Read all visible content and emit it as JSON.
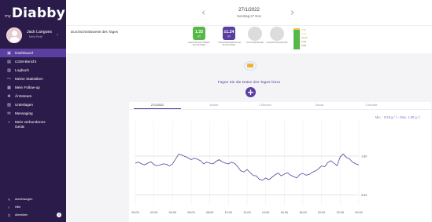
{
  "brand": {
    "prefix": "my",
    "name": "Diabby"
  },
  "user": {
    "name": "Jack Langues",
    "role": "Mein Profil",
    "caret": "⌄"
  },
  "nav": [
    {
      "label": "Dashboard",
      "icon": "▣",
      "icon_name": "dashboard-icon",
      "active": true
    },
    {
      "label": "CGM-Bericht",
      "icon": "▤",
      "icon_name": "report-icon"
    },
    {
      "label": "Logbuch",
      "icon": "▥",
      "icon_name": "logbook-icon"
    },
    {
      "label": "Meine Statistiken",
      "icon": "〜",
      "icon_name": "statistics-icon"
    },
    {
      "label": "Mein Follow-up",
      "icon": "▦",
      "icon_name": "followup-icon"
    },
    {
      "label": "Ärzteteam",
      "icon": "✚",
      "icon_name": "doctor-team-icon"
    },
    {
      "label": "Unterlagen",
      "icon": "▧",
      "icon_name": "documents-icon"
    },
    {
      "label": "Messaging",
      "icon": "✉",
      "icon_name": "messaging-icon"
    },
    {
      "label": "Mein verbundenes Gerät",
      "icon": "⌁",
      "icon_name": "device-icon"
    }
  ],
  "bottom_links": [
    {
      "label": "Anmerkungen",
      "icon": "✎",
      "icon_name": "notes-icon"
    },
    {
      "label": "Hilfe",
      "icon": "?",
      "icon_name": "help-icon"
    },
    {
      "label": "Abmelden",
      "icon": "⏻",
      "icon_name": "logout-icon"
    }
  ],
  "info_icon": "i",
  "date": {
    "main": "27/1/2022",
    "sub": "Sonntag 27 Nov",
    "prev": "‹",
    "next": "›"
  },
  "averages": {
    "label": "Durchschnittswerte des Tages",
    "tiles": [
      {
        "value": "1.33",
        "unit": "g/l",
        "label": "DURCHSCHNITTSWERT BLUTZUCKER",
        "color": "#56b947"
      },
      {
        "value": "±1.24",
        "unit": "g/l",
        "label": "STANDARDABWEICHUNG BLUTZUCKER",
        "color": "#5a3fa0"
      }
    ],
    "circles": [
      {
        "label": "HYPOS ERKENNEN"
      },
      {
        "label": "GESAMTINSULINDOSIS"
      }
    ],
    "time_in_range": [
      {
        "value": "4.0%",
        "color": "#f2a43c"
      },
      {
        "value": "0.0%",
        "color": "#f2c64a"
      },
      {
        "value": "94.0%",
        "color": "#56b947"
      },
      {
        "value": "2.0%",
        "color": "#e24a3d"
      },
      {
        "value": "0.0%",
        "color": "#8c4a3d"
      }
    ]
  },
  "empty_state": {
    "text": "Fügen Sie die Daten des Tages hinzu",
    "add_label": "+"
  },
  "chart": {
    "tabs": [
      "27/1/2022",
      "Woche",
      "2 Wochen",
      "Monat",
      "3 Monate"
    ],
    "minmax": "Min. : 0,68 g / l – Max. 1,90 g / l",
    "x_labels": [
      "00:00",
      "02:00",
      "04:00",
      "06:00",
      "08:00",
      "10:00",
      "12:00",
      "14:00",
      "16:00",
      "18:00",
      "20:00",
      "22:00",
      "00:00"
    ]
  },
  "chart_data": {
    "type": "line",
    "ylim": [
      0.4,
      2.8
    ],
    "thresholds": [
      {
        "value": 1.8,
        "label": "1.80"
      },
      {
        "value": 0.7,
        "label": "0.69"
      }
    ],
    "series": [
      {
        "color": "#5a3fa0",
        "x": [
          0,
          0.33,
          0.67,
          1,
          1.33,
          1.67,
          2,
          2.33,
          2.67,
          3,
          3.33,
          3.67,
          4,
          4.33,
          4.67,
          5,
          5.33,
          5.67,
          6,
          6.33,
          6.67,
          7,
          7.33,
          7.67,
          8,
          8.33,
          8.67,
          9,
          9.33,
          9.67,
          10,
          10.33,
          10.67,
          11,
          11.33,
          11.67,
          12,
          12.33,
          12.67,
          13,
          13.33,
          13.67,
          14,
          14.33,
          14.67,
          15,
          15.33,
          15.67,
          16,
          16.33,
          16.67,
          17,
          17.33,
          17.67,
          18,
          18.33,
          18.67,
          19,
          19.33,
          19.67,
          20,
          20.33,
          20.67,
          21,
          21.33,
          21.67,
          22,
          22.33,
          22.67,
          23,
          23.33,
          23.67,
          24
        ],
        "values": [
          1.6,
          1.63,
          1.58,
          1.55,
          1.6,
          1.64,
          1.56,
          1.53,
          1.55,
          1.58,
          1.57,
          1.52,
          1.58,
          1.72,
          1.86,
          1.83,
          1.79,
          1.75,
          1.7,
          1.74,
          1.71,
          1.67,
          1.58,
          1.63,
          1.6,
          1.58,
          1.65,
          1.7,
          1.64,
          1.6,
          1.58,
          1.63,
          1.59,
          1.5,
          1.38,
          1.35,
          1.42,
          1.33,
          1.25,
          1.24,
          1.14,
          1.12,
          1.18,
          1.13,
          1.2,
          1.27,
          1.32,
          1.24,
          1.29,
          1.33,
          1.26,
          1.22,
          1.18,
          1.28,
          1.31,
          1.26,
          1.28,
          1.34,
          1.38,
          1.44,
          1.52,
          1.5,
          1.62,
          1.67,
          1.6,
          1.53,
          1.78,
          1.86,
          1.76,
          1.72,
          1.63,
          1.58,
          1.55
        ]
      }
    ]
  }
}
